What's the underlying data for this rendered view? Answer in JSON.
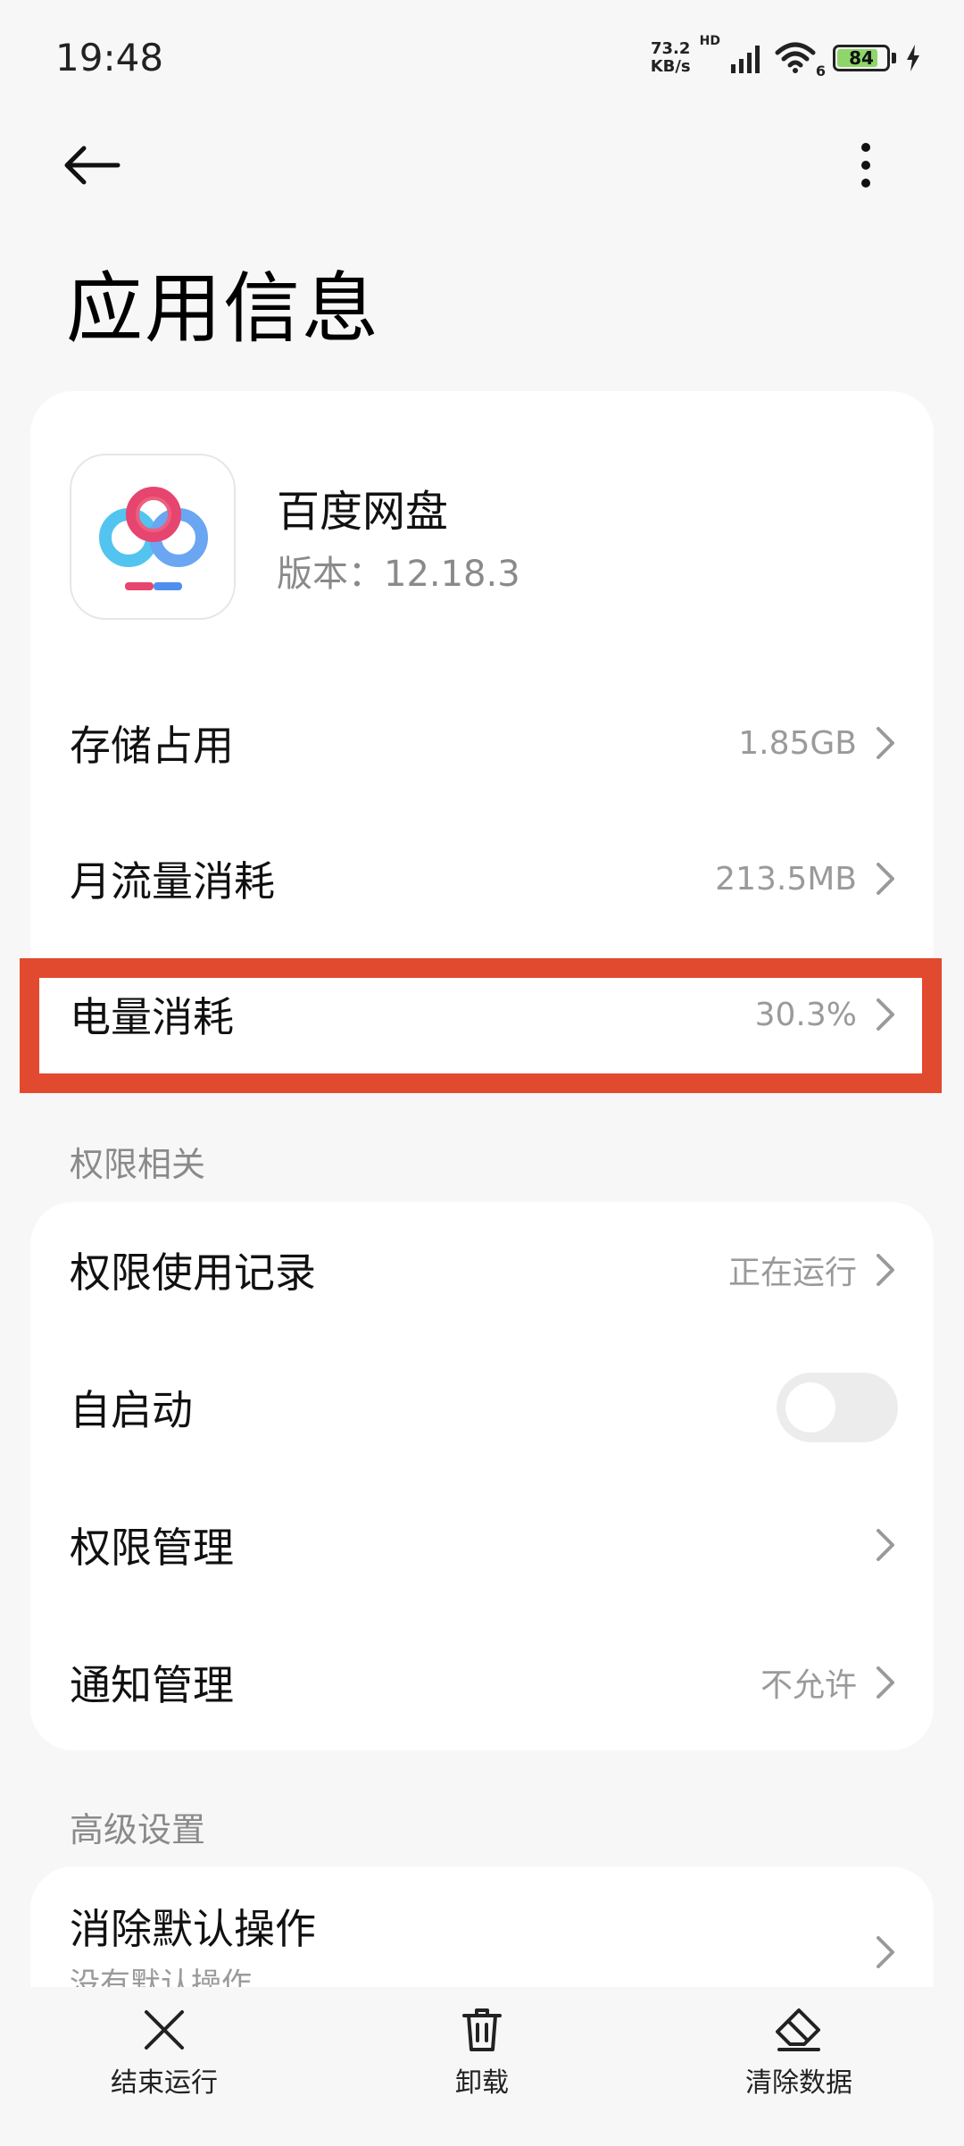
{
  "status_bar": {
    "time": "19:48",
    "net_speed_value": "73.2",
    "net_speed_unit": "KB/s",
    "hd_label": "HD",
    "wifi_label": "6",
    "battery_level": "84",
    "battery_fraction": 0.84
  },
  "header": {
    "title": "应用信息"
  },
  "app": {
    "name": "百度网盘",
    "version": "版本：12.18.3"
  },
  "info_rows": [
    {
      "label": "存储占用",
      "value": "1.85GB"
    },
    {
      "label": "月流量消耗",
      "value": "213.5MB"
    },
    {
      "label": "电量消耗",
      "value": "30.3%"
    }
  ],
  "permissions": {
    "section_title": "权限相关",
    "usage_label": "权限使用记录",
    "usage_value": "正在运行",
    "autostart_label": "自启动",
    "autostart_on": false,
    "manage_label": "权限管理",
    "notify_label": "通知管理",
    "notify_value": "不允许"
  },
  "advanced": {
    "section_title": "高级设置",
    "clear_default_label": "消除默认操作",
    "clear_default_sub": "没有默认操作"
  },
  "bottom_actions": {
    "stop": "结束运行",
    "uninstall": "卸载",
    "clear_data": "清除数据"
  },
  "colors": {
    "highlight": "#e24a2f",
    "battery": "#8ed66a"
  }
}
